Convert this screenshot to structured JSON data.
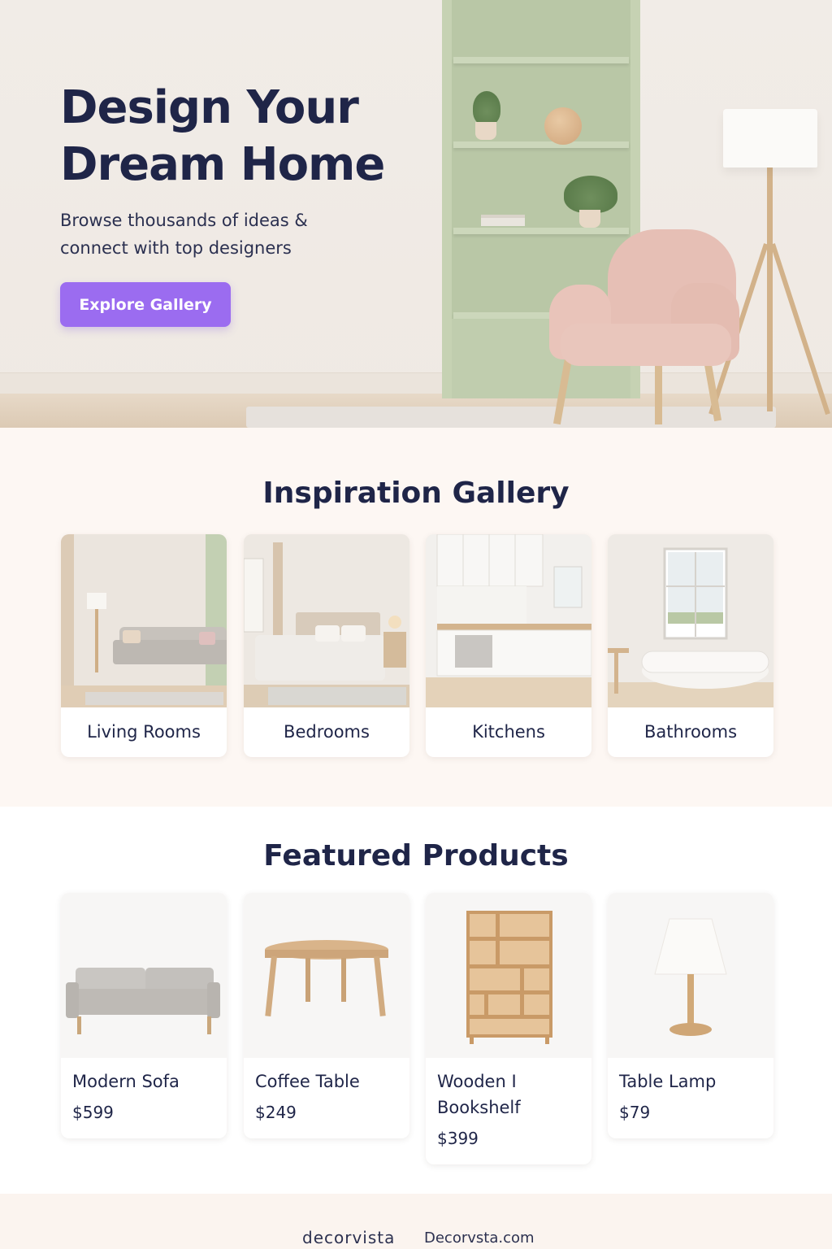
{
  "hero": {
    "title": "Design Your Dream Home",
    "subtitle": "Browse thousands of ideas & connect with top designers",
    "cta_label": "Explore Gallery",
    "cta_color": "#9b6cf0"
  },
  "gallery": {
    "title": "Inspiration Gallery",
    "items": [
      {
        "label": "Living Rooms"
      },
      {
        "label": "Bedrooms"
      },
      {
        "label": "Kitchens"
      },
      {
        "label": "Bathrooms"
      }
    ]
  },
  "products": {
    "title": "Featured Products",
    "items": [
      {
        "name": "Modern Sofa",
        "price": "$599"
      },
      {
        "name": "Coffee Table",
        "price": "$249"
      },
      {
        "name": "Wooden I Bookshelf",
        "price": "$399"
      },
      {
        "name": "Table Lamp",
        "price": "$79"
      }
    ]
  },
  "footer": {
    "logo": "decorvista",
    "url": "Decorvsta.com"
  }
}
